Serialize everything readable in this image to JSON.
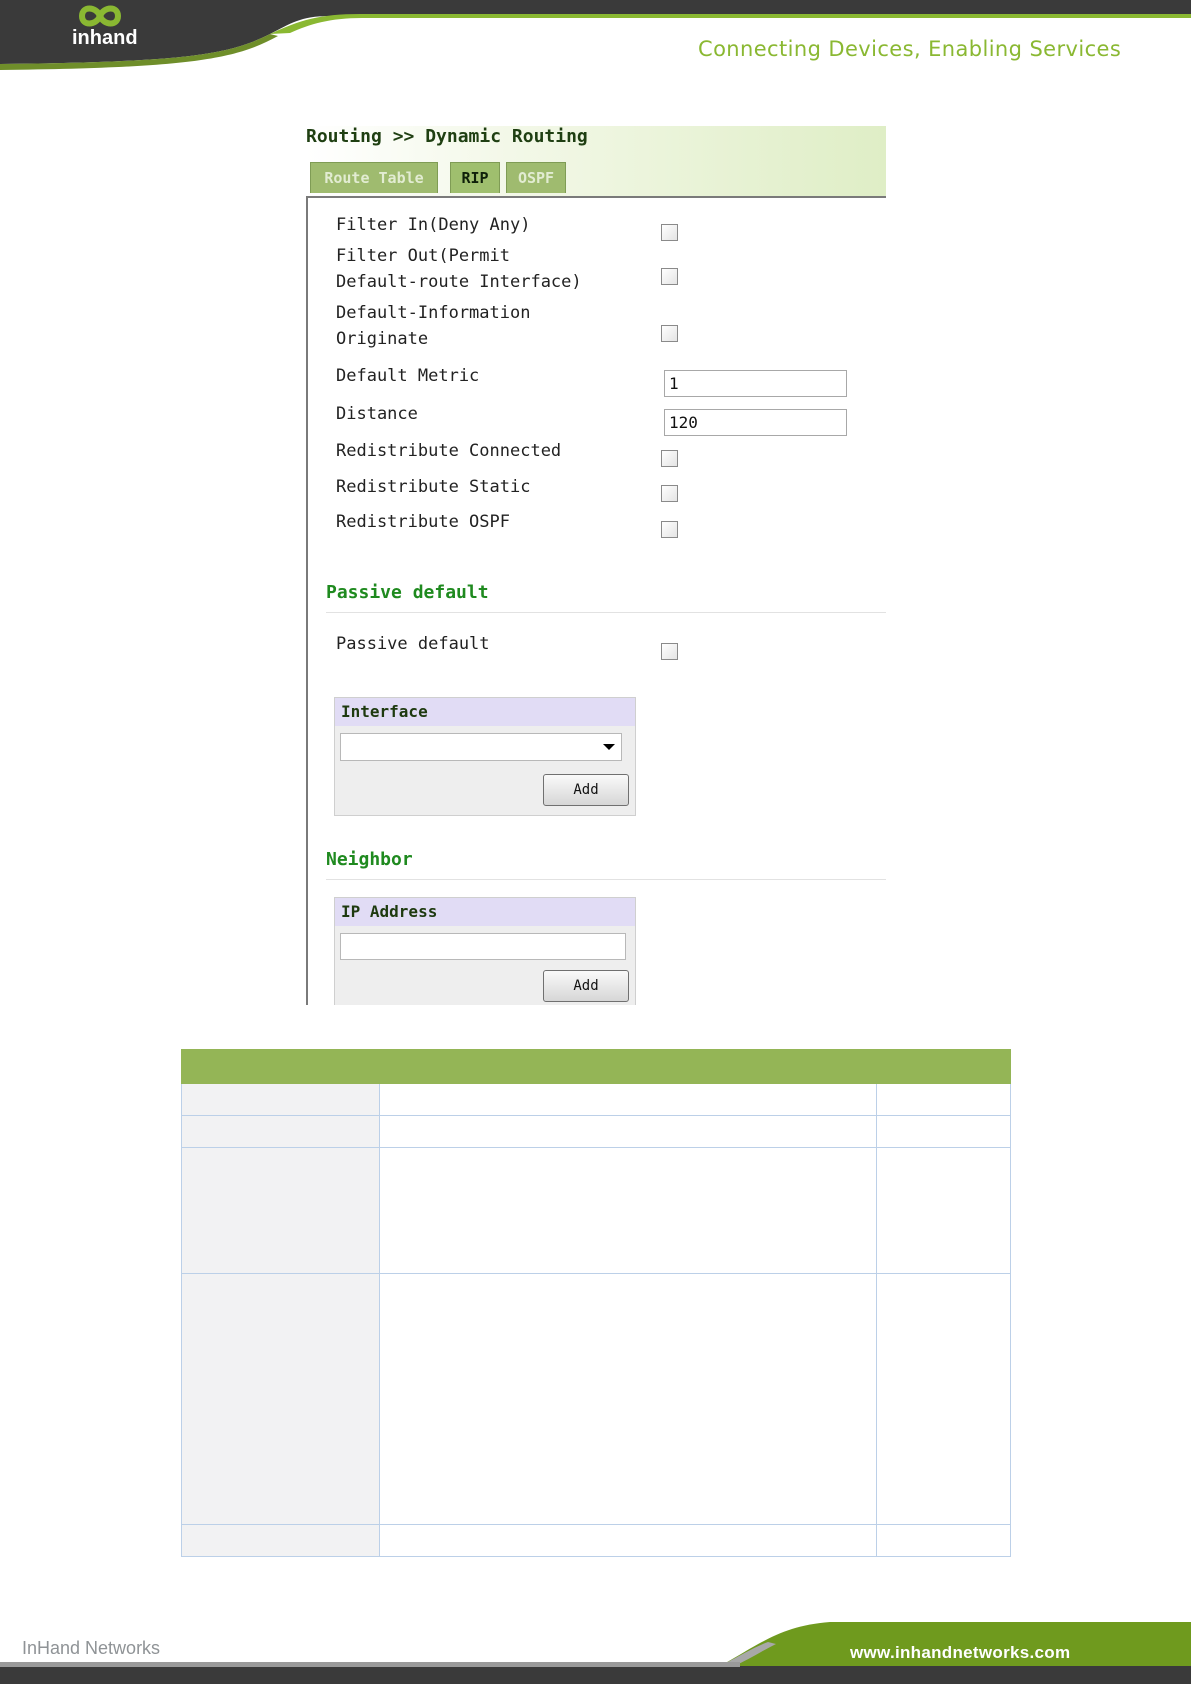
{
  "header": {
    "logo_text": "inhand",
    "tagline": "Connecting Devices, Enabling Services"
  },
  "screen": {
    "breadcrumb": "Routing >> Dynamic Routing",
    "tabs": [
      "Route Table",
      "RIP",
      "OSPF"
    ],
    "active_tab": "RIP",
    "fields": {
      "filter_in": "Filter In(Deny Any)",
      "filter_out": "Filter Out(Permit\nDefault-route Interface)",
      "default_info": "Default-Information\nOriginate",
      "default_metric": "Default Metric",
      "default_metric_value": "1",
      "distance": "Distance",
      "distance_value": "120",
      "redist_connected": "Redistribute Connected",
      "redist_static": "Redistribute Static",
      "redist_ospf": "Redistribute OSPF"
    },
    "passive": {
      "section_title": "Passive default",
      "label": "Passive default",
      "interface_header": "Interface",
      "add_label": "Add"
    },
    "neighbor": {
      "section_title": "Neighbor",
      "ip_header": "IP Address",
      "add_label": "Add"
    }
  },
  "footer": {
    "left": "InHand Networks",
    "right": "www.inhandnetworks.com"
  },
  "colors": {
    "brand_green": "#8ab832",
    "table_header": "#94b556",
    "section_green": "#1f8a1f"
  }
}
